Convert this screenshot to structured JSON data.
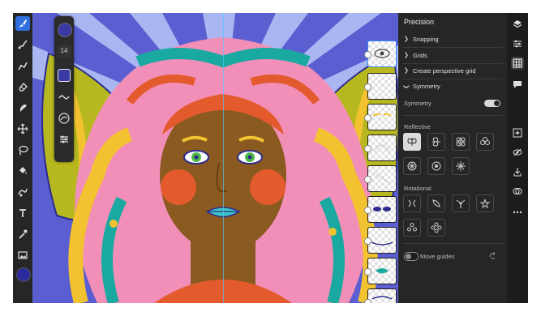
{
  "panel": {
    "title": "Precision",
    "sections": [
      {
        "label": "Snapping",
        "expanded": false
      },
      {
        "label": "Grids",
        "expanded": false
      },
      {
        "label": "Create perspective grid",
        "expanded": false
      },
      {
        "label": "Symmetry",
        "expanded": true
      }
    ],
    "symmetry_toggle_label": "Symmetry",
    "symmetry_on": true,
    "reflective_label": "Reflective",
    "rotational_label": "Rotational",
    "move_guides_label": "Move guides",
    "move_guides_on": false
  },
  "brush_panel": {
    "size_value": "14"
  },
  "colors": {
    "accent": "#2f6fe0",
    "panel_bg": "#262626",
    "primary_color": "#2a2a9c"
  },
  "tools": [
    "pixel-brush-icon",
    "live-brush-icon",
    "vector-brush-icon",
    "eraser-icon",
    "smudge-icon",
    "move-icon",
    "lasso-icon",
    "fill-icon",
    "liquify-icon",
    "text-icon",
    "eyedropper-icon",
    "image-icon"
  ],
  "right_rail": [
    "layers-icon",
    "layer-properties-icon",
    "precision-grid-icon",
    "comments-icon",
    "add-layer-icon",
    "hide-layer-icon",
    "import-icon",
    "blend-icon",
    "more-icon"
  ]
}
